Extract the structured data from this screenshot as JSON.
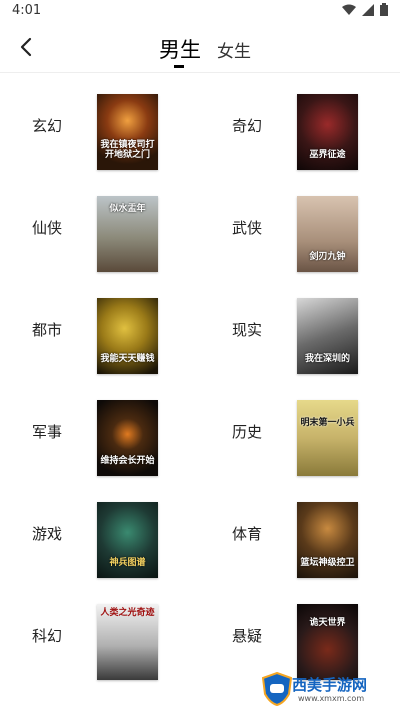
{
  "status": {
    "time": "4:01"
  },
  "header": {
    "tabs": [
      {
        "label": "男生"
      },
      {
        "label": "女生"
      }
    ],
    "active_tab": "男生"
  },
  "categories": [
    {
      "label": "玄幻",
      "cover_title": "我在镇夜司打开地狱之门",
      "cover_color": "#6b3a1a"
    },
    {
      "label": "奇幻",
      "cover_title": "巫界征途",
      "cover_color": "#3a1616"
    },
    {
      "label": "仙侠",
      "cover_title": "似水盂年",
      "cover_color": "#8c8a7a"
    },
    {
      "label": "武侠",
      "cover_title": "剑刃九钟",
      "cover_color": "#a88f7a"
    },
    {
      "label": "都市",
      "cover_title": "我能天天赚钱",
      "cover_color": "#3a2f10"
    },
    {
      "label": "现实",
      "cover_title": "我在深圳的",
      "cover_color": "#5a5a5a"
    },
    {
      "label": "军事",
      "cover_title": "维持会长开始",
      "cover_color": "#1a1410"
    },
    {
      "label": "历史",
      "cover_title": "明末第一小兵",
      "cover_color": "#c7b36a"
    },
    {
      "label": "游戏",
      "cover_title": "神兵图谱",
      "cover_color": "#1e3a34"
    },
    {
      "label": "体育",
      "cover_title": "篮坛神级控卫",
      "cover_color": "#3a2a1a"
    },
    {
      "label": "科幻",
      "cover_title": "人类之光奇迹",
      "cover_color": "#eeeeee"
    },
    {
      "label": "悬疑",
      "cover_title": "诡天世界",
      "cover_color": "#2a1a1a"
    }
  ],
  "watermark": {
    "text": "西美手游网",
    "url": "www.xmxm.com"
  },
  "colors": {
    "accent": "#000000",
    "divider": "#eeeeee",
    "watermark": "#1565c0"
  }
}
